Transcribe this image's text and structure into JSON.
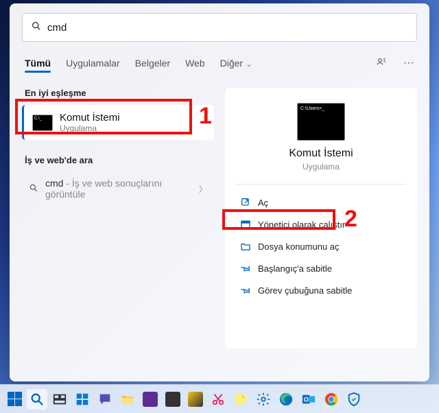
{
  "search": {
    "query": "cmd"
  },
  "tabs": {
    "all": "Tümü",
    "apps": "Uygulamalar",
    "docs": "Belgeler",
    "web": "Web",
    "more": "Diğer"
  },
  "left": {
    "best_match_header": "En iyi eşleşme",
    "best_match": {
      "title": "Komut İstemi",
      "subtitle": "Uygulama"
    },
    "search_web_header": "İş ve web'de ara",
    "search_web_label": "cmd",
    "search_web_hint": " - İş ve web sonuçlarını görüntüle"
  },
  "preview": {
    "title": "Komut İstemi",
    "subtitle": "Uygulama",
    "actions": {
      "open": "Aç",
      "run_admin": "Yönetici olarak çalıştır",
      "open_location": "Dosya konumunu aç",
      "pin_start": "Başlangıç'a sabitle",
      "pin_taskbar": "Görev çubuğuna sabitle"
    }
  },
  "annotations": {
    "one": "1",
    "two": "2"
  }
}
